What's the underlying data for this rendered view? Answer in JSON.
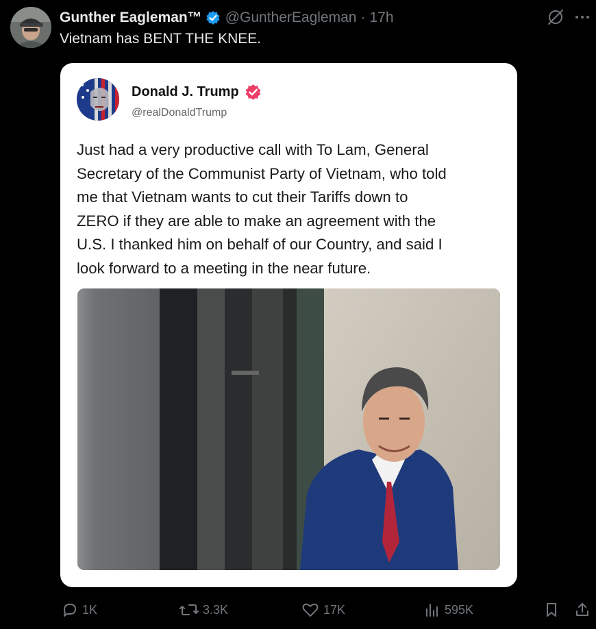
{
  "tweet": {
    "author_name": "Gunther Eagleman™",
    "handle": "@GuntherEagleman",
    "separator": "·",
    "time": "17h",
    "text": "Vietnam has BENT THE KNEE.",
    "verified_color": "#1d9bf0"
  },
  "quoted_post": {
    "author_name": "Donald J. Trump",
    "handle": "@realDonaldTrump",
    "badge_color": "#ee3e6a",
    "text_lines": [
      "Just had a very productive call with To Lam, General",
      "Secretary of the Communist Party of Vietnam, who told",
      "me that Vietnam wants to cut their Tariffs down to",
      "ZERO if they are able to make an agreement with the",
      "U.S. I thanked him on behalf of our Country, and said I",
      "look forward to a meeting in the near future."
    ]
  },
  "actions": {
    "replies": "1K",
    "reposts": "3.3K",
    "likes": "17K",
    "views": "595K"
  },
  "icons": {
    "top": [
      "grok-icon",
      "more-icon"
    ],
    "bottom": [
      "reply-icon",
      "repost-icon",
      "like-icon",
      "views-icon",
      "bookmark-icon",
      "share-icon"
    ]
  }
}
